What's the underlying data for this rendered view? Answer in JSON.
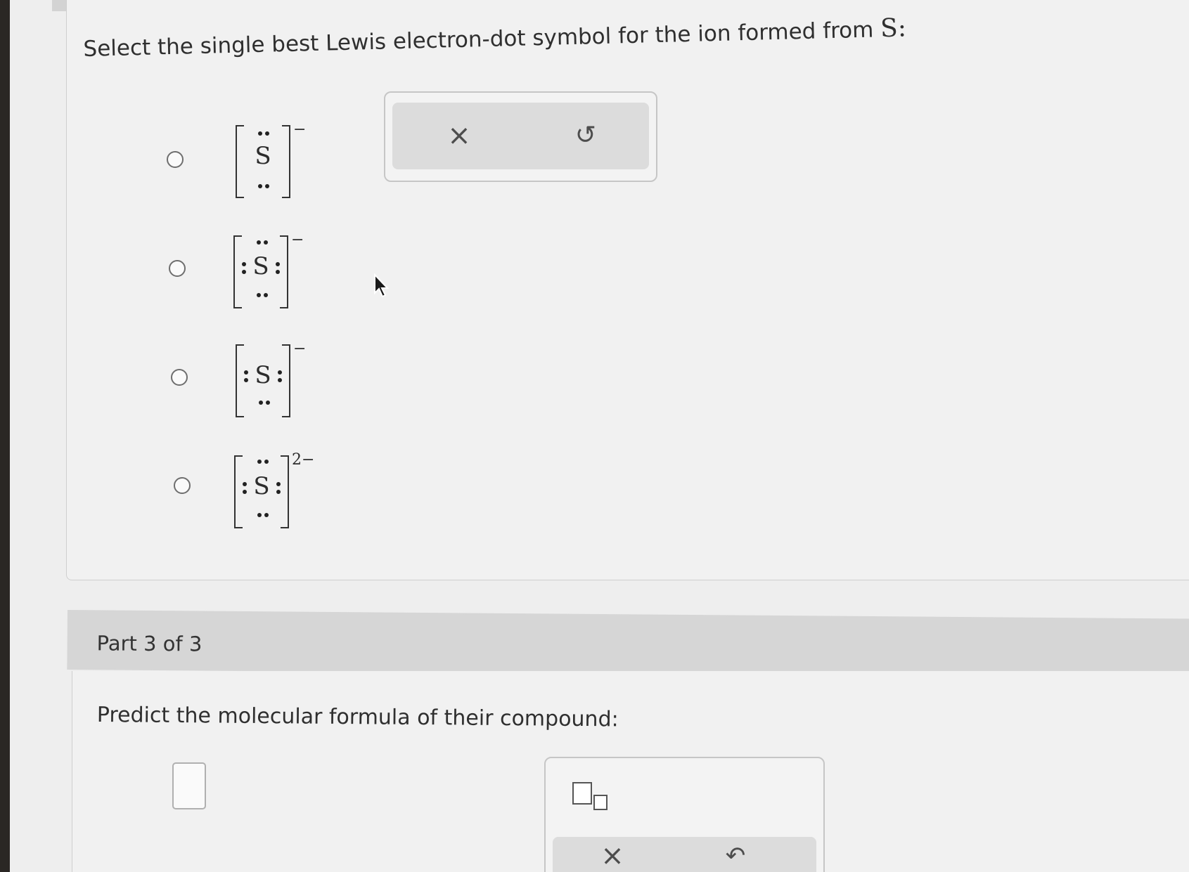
{
  "part2": {
    "question_text": "Select the single best Lewis electron-dot symbol for the ion formed from",
    "question_element": "S:",
    "options": [
      {
        "symbol": "S",
        "charge": "−"
      },
      {
        "symbol": "S",
        "charge": "−"
      },
      {
        "symbol": "S",
        "charge": "−"
      },
      {
        "symbol": "S",
        "charge": "2−"
      }
    ],
    "toolbar": {
      "clear_label": "×",
      "undo_label": "↺"
    }
  },
  "part3": {
    "title": "Part 3 of 3",
    "question_text": "Predict the molecular formula of their compound:",
    "toolbar": {
      "clear_label": "×",
      "undo_label": "↶"
    }
  },
  "icons": {
    "clear": "close-icon",
    "undo": "undo-icon",
    "subscript": "subscript-template-icon",
    "cursor": "mouse-pointer-icon"
  }
}
